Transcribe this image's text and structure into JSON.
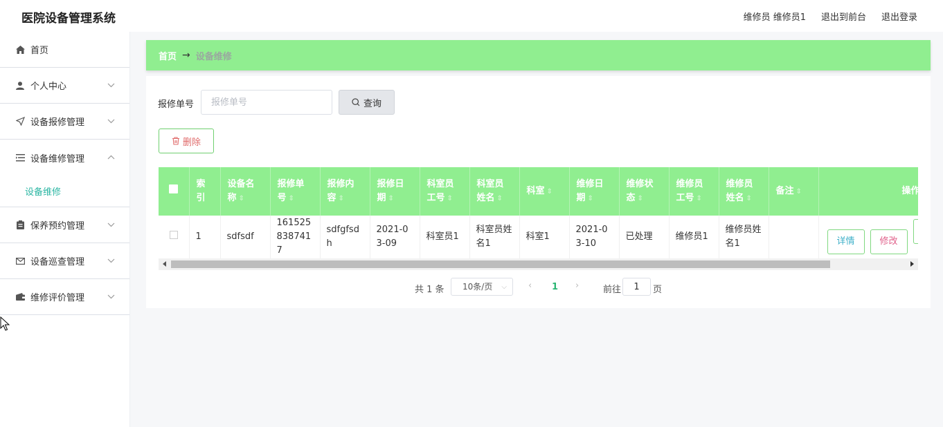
{
  "header": {
    "app_title": "医院设备管理系统",
    "user_label": "维修员 维修员1",
    "front_link": "退出到前台",
    "logout_link": "退出登录"
  },
  "sidebar": {
    "items": [
      {
        "label": "首页",
        "icon": "home-icon"
      },
      {
        "label": "个人中心",
        "icon": "user-icon"
      },
      {
        "label": "设备报修管理",
        "icon": "send-icon"
      },
      {
        "label": "设备维修管理",
        "icon": "list-icon",
        "submenu": "设备维修"
      },
      {
        "label": "保养预约管理",
        "icon": "clipboard-icon"
      },
      {
        "label": "设备巡查管理",
        "icon": "mail-icon"
      },
      {
        "label": "维修评价管理",
        "icon": "wallet-icon"
      }
    ]
  },
  "breadcrumb": {
    "home": "首页",
    "arrow": "→",
    "current": "设备维修"
  },
  "search": {
    "label": "报修单号",
    "placeholder": "报修单号",
    "button": "查询"
  },
  "toolbar": {
    "delete_label": "删除"
  },
  "table": {
    "columns": [
      "索引",
      "设备名称",
      "报修单号",
      "报修内容",
      "报修日期",
      "科室员工号",
      "科室员姓名",
      "科室",
      "维修日期",
      "维修状态",
      "维修员工号",
      "维修员姓名",
      "备注",
      "操作"
    ],
    "rows": [
      {
        "index": "1",
        "device_name": "sdfsdf",
        "repair_no": "1615258387417",
        "repair_content": "sdfgfsdh",
        "repair_date": "2021-03-09",
        "dept_staff_no": "科室员1",
        "dept_staff_name": "科室员姓名1",
        "dept": "科室1",
        "maint_date": "2021-03-10",
        "maint_status": "已处理",
        "maint_staff_no": "维修员1",
        "maint_staff_name": "维修员姓名1",
        "remark": "",
        "detail_label": "详情",
        "edit_label": "修改"
      }
    ]
  },
  "pagination": {
    "total": "共 1 条",
    "page_size": "10条/页",
    "current_page": "1",
    "goto_label": "前往",
    "goto_value": "1",
    "page_unit": "页"
  },
  "colors": {
    "accent_green": "#90ee90",
    "active_teal": "#2bb6a3"
  }
}
